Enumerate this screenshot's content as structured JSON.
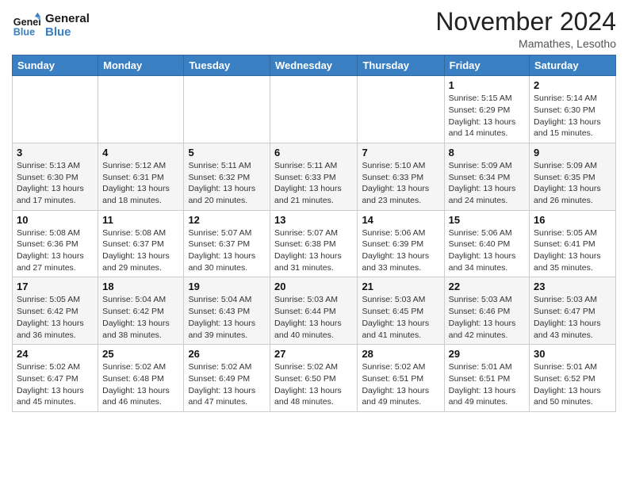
{
  "header": {
    "logo_line1": "General",
    "logo_line2": "Blue",
    "month_title": "November 2024",
    "location": "Mamathes, Lesotho"
  },
  "days_of_week": [
    "Sunday",
    "Monday",
    "Tuesday",
    "Wednesday",
    "Thursday",
    "Friday",
    "Saturday"
  ],
  "weeks": [
    [
      {
        "day": "",
        "info": ""
      },
      {
        "day": "",
        "info": ""
      },
      {
        "day": "",
        "info": ""
      },
      {
        "day": "",
        "info": ""
      },
      {
        "day": "",
        "info": ""
      },
      {
        "day": "1",
        "info": "Sunrise: 5:15 AM\nSunset: 6:29 PM\nDaylight: 13 hours and 14 minutes."
      },
      {
        "day": "2",
        "info": "Sunrise: 5:14 AM\nSunset: 6:30 PM\nDaylight: 13 hours and 15 minutes."
      }
    ],
    [
      {
        "day": "3",
        "info": "Sunrise: 5:13 AM\nSunset: 6:30 PM\nDaylight: 13 hours and 17 minutes."
      },
      {
        "day": "4",
        "info": "Sunrise: 5:12 AM\nSunset: 6:31 PM\nDaylight: 13 hours and 18 minutes."
      },
      {
        "day": "5",
        "info": "Sunrise: 5:11 AM\nSunset: 6:32 PM\nDaylight: 13 hours and 20 minutes."
      },
      {
        "day": "6",
        "info": "Sunrise: 5:11 AM\nSunset: 6:33 PM\nDaylight: 13 hours and 21 minutes."
      },
      {
        "day": "7",
        "info": "Sunrise: 5:10 AM\nSunset: 6:33 PM\nDaylight: 13 hours and 23 minutes."
      },
      {
        "day": "8",
        "info": "Sunrise: 5:09 AM\nSunset: 6:34 PM\nDaylight: 13 hours and 24 minutes."
      },
      {
        "day": "9",
        "info": "Sunrise: 5:09 AM\nSunset: 6:35 PM\nDaylight: 13 hours and 26 minutes."
      }
    ],
    [
      {
        "day": "10",
        "info": "Sunrise: 5:08 AM\nSunset: 6:36 PM\nDaylight: 13 hours and 27 minutes."
      },
      {
        "day": "11",
        "info": "Sunrise: 5:08 AM\nSunset: 6:37 PM\nDaylight: 13 hours and 29 minutes."
      },
      {
        "day": "12",
        "info": "Sunrise: 5:07 AM\nSunset: 6:37 PM\nDaylight: 13 hours and 30 minutes."
      },
      {
        "day": "13",
        "info": "Sunrise: 5:07 AM\nSunset: 6:38 PM\nDaylight: 13 hours and 31 minutes."
      },
      {
        "day": "14",
        "info": "Sunrise: 5:06 AM\nSunset: 6:39 PM\nDaylight: 13 hours and 33 minutes."
      },
      {
        "day": "15",
        "info": "Sunrise: 5:06 AM\nSunset: 6:40 PM\nDaylight: 13 hours and 34 minutes."
      },
      {
        "day": "16",
        "info": "Sunrise: 5:05 AM\nSunset: 6:41 PM\nDaylight: 13 hours and 35 minutes."
      }
    ],
    [
      {
        "day": "17",
        "info": "Sunrise: 5:05 AM\nSunset: 6:42 PM\nDaylight: 13 hours and 36 minutes."
      },
      {
        "day": "18",
        "info": "Sunrise: 5:04 AM\nSunset: 6:42 PM\nDaylight: 13 hours and 38 minutes."
      },
      {
        "day": "19",
        "info": "Sunrise: 5:04 AM\nSunset: 6:43 PM\nDaylight: 13 hours and 39 minutes."
      },
      {
        "day": "20",
        "info": "Sunrise: 5:03 AM\nSunset: 6:44 PM\nDaylight: 13 hours and 40 minutes."
      },
      {
        "day": "21",
        "info": "Sunrise: 5:03 AM\nSunset: 6:45 PM\nDaylight: 13 hours and 41 minutes."
      },
      {
        "day": "22",
        "info": "Sunrise: 5:03 AM\nSunset: 6:46 PM\nDaylight: 13 hours and 42 minutes."
      },
      {
        "day": "23",
        "info": "Sunrise: 5:03 AM\nSunset: 6:47 PM\nDaylight: 13 hours and 43 minutes."
      }
    ],
    [
      {
        "day": "24",
        "info": "Sunrise: 5:02 AM\nSunset: 6:47 PM\nDaylight: 13 hours and 45 minutes."
      },
      {
        "day": "25",
        "info": "Sunrise: 5:02 AM\nSunset: 6:48 PM\nDaylight: 13 hours and 46 minutes."
      },
      {
        "day": "26",
        "info": "Sunrise: 5:02 AM\nSunset: 6:49 PM\nDaylight: 13 hours and 47 minutes."
      },
      {
        "day": "27",
        "info": "Sunrise: 5:02 AM\nSunset: 6:50 PM\nDaylight: 13 hours and 48 minutes."
      },
      {
        "day": "28",
        "info": "Sunrise: 5:02 AM\nSunset: 6:51 PM\nDaylight: 13 hours and 49 minutes."
      },
      {
        "day": "29",
        "info": "Sunrise: 5:01 AM\nSunset: 6:51 PM\nDaylight: 13 hours and 49 minutes."
      },
      {
        "day": "30",
        "info": "Sunrise: 5:01 AM\nSunset: 6:52 PM\nDaylight: 13 hours and 50 minutes."
      }
    ]
  ]
}
